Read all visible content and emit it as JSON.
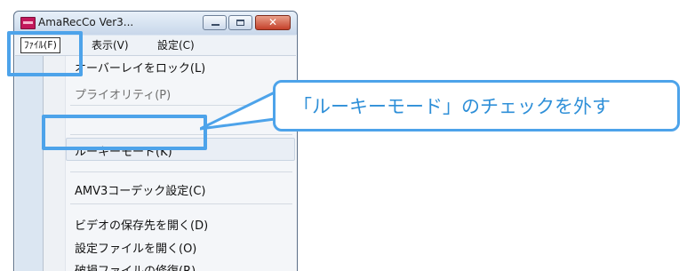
{
  "window": {
    "title": "AmaRecCo Ver3...",
    "close_glyph": "✕"
  },
  "menubar": {
    "file": "ﾌｧｲﾙ(F)",
    "view": "表示(V)",
    "settings": "設定(C)"
  },
  "dropdown": {
    "items": [
      "オーバーレイをロック(L)",
      "プライオリティ(P)",
      "ルーキーモード(K)",
      "AMV3コーデック設定(C)",
      "ビデオの保存先を開く(D)",
      "設定ファイルを開く(O)",
      "破損ファイルの修復(R)"
    ]
  },
  "callout": {
    "text": "「ルーキーモード」のチェックを外す"
  },
  "colors": {
    "highlight": "#4da3ea",
    "callout_text": "#2e8fd8"
  }
}
